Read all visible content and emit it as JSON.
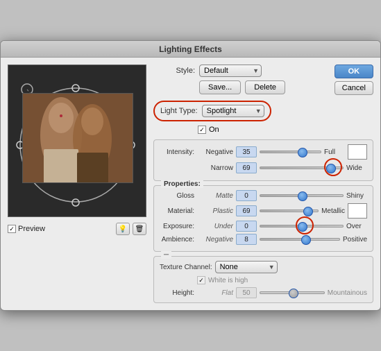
{
  "dialog": {
    "title": "Lighting Effects",
    "style_label": "Style:",
    "style_value": "Default",
    "save_button": "Save...",
    "delete_button": "Delete",
    "ok_button": "OK",
    "cancel_button": "Cancel",
    "light_type_label": "Light Type:",
    "light_type_value": "Spotlight",
    "on_checkbox": "On",
    "intensity": {
      "label": "Intensity:",
      "left": "Negative",
      "value": "35",
      "right": "Full",
      "thumb_pos": "62"
    },
    "focus": {
      "left": "Narrow",
      "value": "69",
      "right": "Wide",
      "thumb_pos": "80"
    },
    "properties_title": "Properties:",
    "gloss": {
      "label": "Gloss",
      "left": "Matte",
      "value": "0",
      "right": "Shiny",
      "thumb_pos": "45"
    },
    "material": {
      "label": "Material:",
      "left": "Plastic",
      "value": "69",
      "right": "Metallic",
      "thumb_pos": "75"
    },
    "exposure": {
      "label": "Exposure:",
      "left": "Under",
      "value": "0",
      "right": "Over",
      "thumb_pos": "45"
    },
    "ambience": {
      "label": "Ambience:",
      "left": "Negative",
      "value": "8",
      "right": "Positive",
      "thumb_pos": "52"
    },
    "texture_channel_label": "Texture Channel:",
    "texture_channel_value": "None",
    "white_is_high": "White is high",
    "height_label": "Height:",
    "height_left": "Flat",
    "height_value": "50",
    "height_right": "Mountainous",
    "height_thumb_pos": "45",
    "preview_label": "Preview"
  }
}
